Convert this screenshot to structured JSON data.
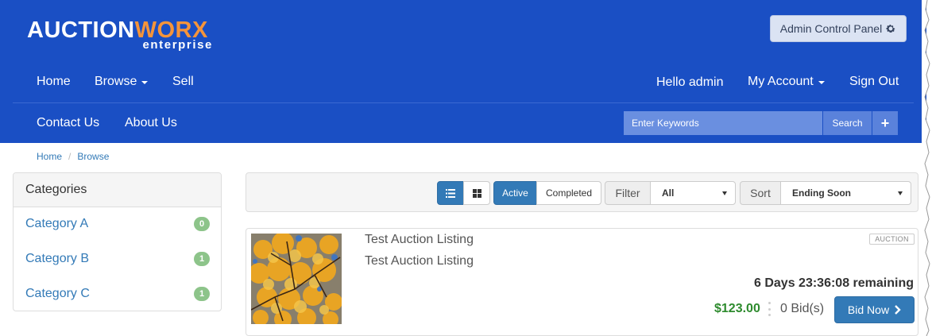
{
  "brand": {
    "logo_part1": "AUCTION",
    "logo_part2": "WORX",
    "logo_sub": "enterprise",
    "primary_color": "#1a4fc4",
    "accent_color": "#f5943a"
  },
  "header": {
    "admin_button_label": "Admin Control Panel",
    "admin_button_icon": "gear-icon"
  },
  "nav": {
    "home": "Home",
    "browse": "Browse",
    "sell": "Sell",
    "hello": "Hello admin",
    "my_account": "My Account",
    "sign_out": "Sign Out",
    "contact_us": "Contact Us",
    "about_us": "About Us"
  },
  "search": {
    "placeholder": "Enter Keywords",
    "button_label": "Search",
    "plus_label": "+"
  },
  "breadcrumb": {
    "items": [
      "Home",
      "Browse"
    ],
    "separator": "/"
  },
  "categories": {
    "title": "Categories",
    "items": [
      {
        "label": "Category A",
        "count": "0"
      },
      {
        "label": "Category B",
        "count": "1"
      },
      {
        "label": "Category C",
        "count": "1"
      }
    ]
  },
  "toolbar": {
    "view_list_icon": "list-icon",
    "view_grid_icon": "grid-icon",
    "active_label": "Active",
    "completed_label": "Completed",
    "filter_label": "Filter",
    "filter_value": "All",
    "sort_label": "Sort",
    "sort_value": "Ending Soon"
  },
  "listing": {
    "title": "Test Auction Listing",
    "subtitle": "Test Auction Listing",
    "type_badge": "AUCTION",
    "time_remaining": "6 Days 23:36:08 remaining",
    "price": "$123.00",
    "bids": "0 Bid(s)",
    "bid_button_label": "Bid Now",
    "price_color": "#2e8b2e"
  }
}
